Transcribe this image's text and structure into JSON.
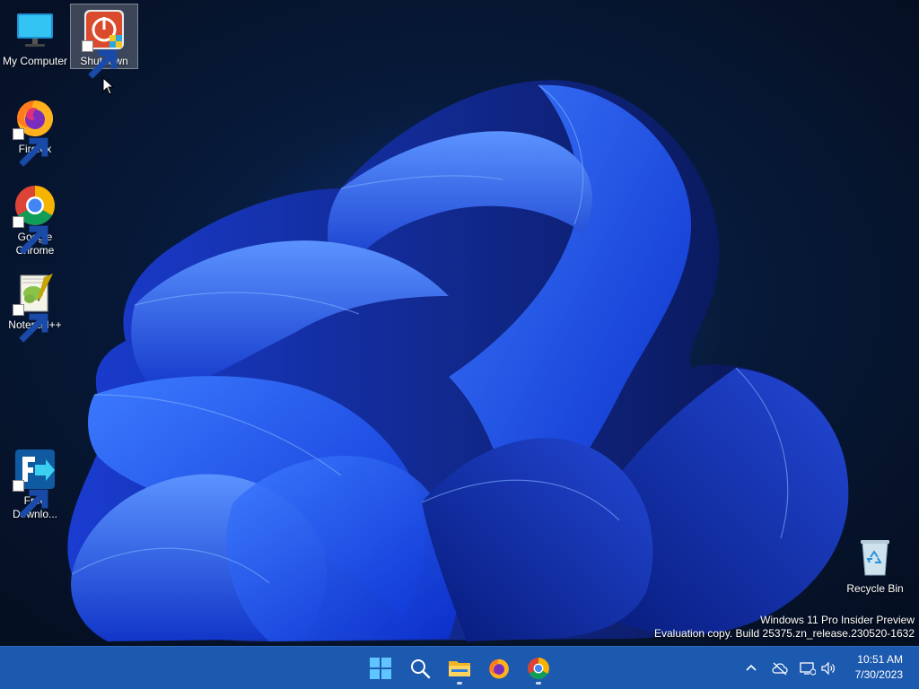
{
  "desktop_icons": {
    "my_computer": {
      "label": "My Computer"
    },
    "shutdown": {
      "label": "Shutdown"
    },
    "firefox": {
      "label": "Firefox"
    },
    "chrome": {
      "label": "Google Chrome"
    },
    "notepadpp": {
      "label": "Notepad++"
    },
    "free_download": {
      "label": "Free Downlo..."
    },
    "recycle_bin": {
      "label": "Recycle Bin"
    }
  },
  "watermark": {
    "line1": "Windows 11 Pro Insider Preview",
    "line2": "Evaluation copy. Build 25375.zn_release.230520-1632"
  },
  "taskbar": {
    "pinned": [
      "start-button",
      "search-button",
      "file-explorer",
      "firefox",
      "chrome"
    ],
    "running": [
      "file-explorer",
      "chrome"
    ]
  },
  "clock": {
    "time": "10:51 AM",
    "date": "7/30/2023"
  },
  "colors": {
    "taskbar": "#1c5aaf",
    "accent_blue": "#1a4dff",
    "desktop_dark": "#071a3a"
  }
}
